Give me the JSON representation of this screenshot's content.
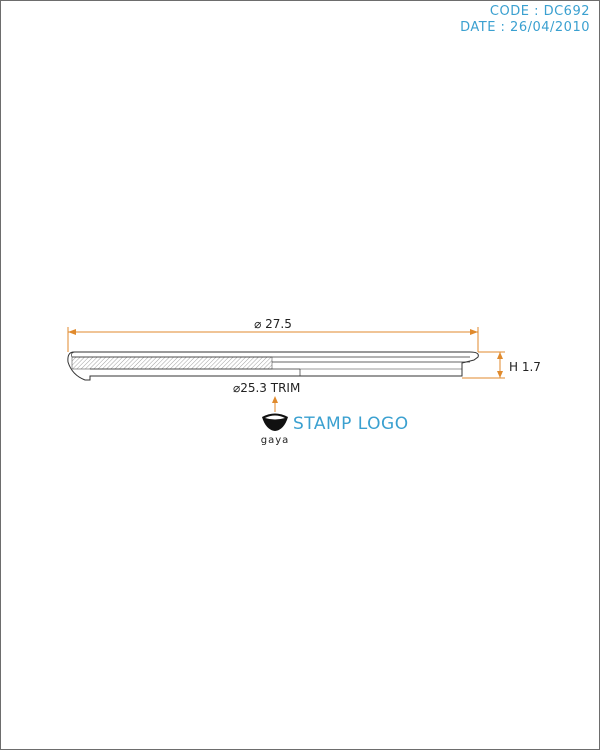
{
  "header": {
    "code": "CODE : DC692",
    "date": "DATE : 26/04/2010"
  },
  "drawing": {
    "outer_diameter": "⌀ 27.5",
    "height": "H 1.7",
    "trim_diameter": "⌀25.3 TRIM",
    "stamp_label": "STAMP LOGO",
    "brand": "gaya"
  },
  "colors": {
    "accent": "#3aa0d0",
    "dimension": "#e08a2c",
    "outline": "#333333"
  }
}
